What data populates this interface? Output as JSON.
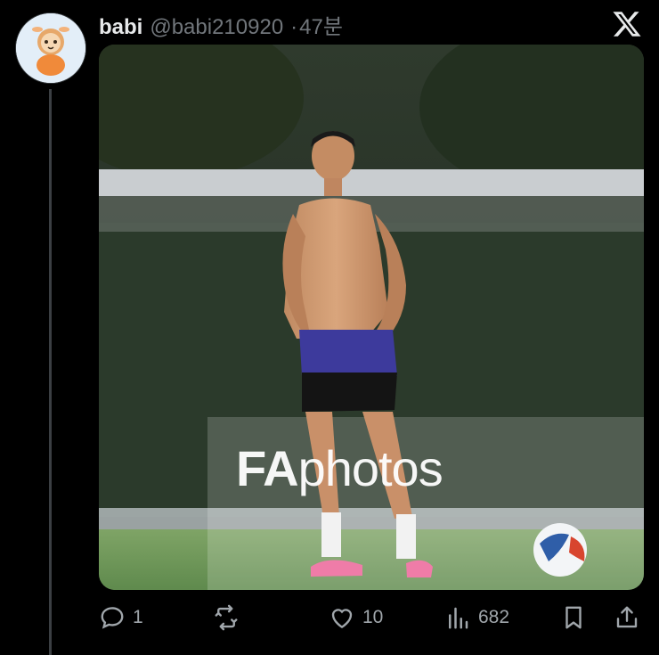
{
  "tweet": {
    "display_name": "babi",
    "handle": "@babi210920",
    "separator": "·",
    "time": "47분"
  },
  "media": {
    "watermark_bold": "FA",
    "watermark_light": "photos"
  },
  "actions": {
    "reply_count": "1",
    "retweet_count": "",
    "like_count": "10",
    "views_count": "682"
  },
  "icons": {
    "brand": "x-logo-icon",
    "reply": "reply-icon",
    "retweet": "retweet-icon",
    "like": "heart-icon",
    "views": "views-icon",
    "bookmark": "bookmark-icon",
    "share": "share-icon"
  },
  "colors": {
    "background": "#000000",
    "text": "#e7e9ea",
    "secondary": "#71767b",
    "action_icon": "#a0a6ab"
  }
}
